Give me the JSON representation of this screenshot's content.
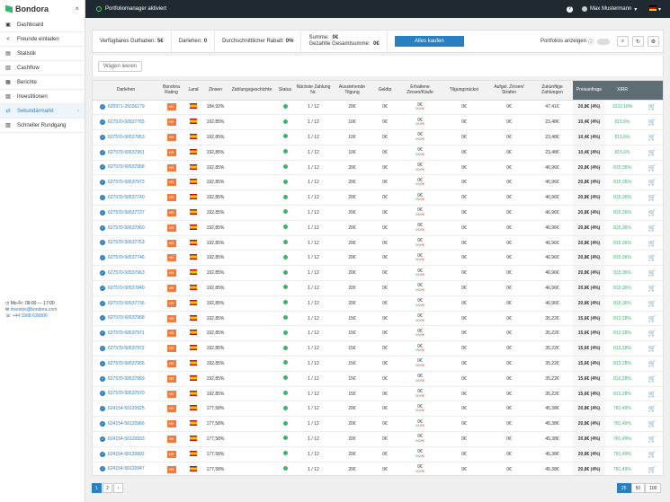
{
  "app": {
    "name": "Bondora",
    "close_icon": "×"
  },
  "nav": [
    {
      "label": "Dashboard",
      "icon": "▣"
    },
    {
      "label": "Freunde einladen",
      "icon": "<"
    },
    {
      "label": "Statistik",
      "icon": "▤"
    },
    {
      "label": "Cashflow",
      "icon": "▥"
    },
    {
      "label": "Berichte",
      "icon": "▦"
    },
    {
      "label": "Investitionen",
      "icon": "▧"
    },
    {
      "label": "Sekundärmarkt",
      "icon": "⇄",
      "active": true
    },
    {
      "label": "Schneller Rundgang",
      "icon": "▨"
    }
  ],
  "contact": {
    "hours": "Mo-Fr: 09:00 — 17:00",
    "email": "investor@bondora.com",
    "phone": "+44 1568 630006"
  },
  "topbar": {
    "status": "Portfoliomanager aktiviert",
    "help": "?",
    "user": "Max Mustermann"
  },
  "summary": {
    "balance_label": "Verfügbares Guthaben:",
    "balance_value": "5€",
    "loans_label": "Darlehen:",
    "loans_value": "0",
    "discount_label": "Durchschnittlicher Rabatt:",
    "discount_value": "0%",
    "sum_label": "Summe:",
    "sum_value": "0€",
    "total_label": "Gezahlte Gesamtsumme:",
    "total_value": "0€",
    "buy_all": "Alles kaufen",
    "show_portfolios": "Portfolios anzeigen"
  },
  "cart": {
    "clear": "Wagen leeren"
  },
  "columns": [
    "Darlehen",
    "Bondora Rating",
    "Land",
    "Zinsen",
    "Zahlungsgeschichte",
    "Status",
    "Nächste Zahlung Nr.",
    "Ausstehende Tilgung",
    "Geldtp",
    "Erhaltene Zinsen/Käufe",
    "Tilgungsrückst",
    "Aufgel. Zinsen/ Strafen",
    "Zukünftige Zahlungen",
    "Preisanfrage",
    "XIRR",
    ""
  ],
  "rows": [
    {
      "id": "620971-29336179",
      "rating": "HR",
      "rate": "184,92%",
      "next": "1 / 12",
      "outstanding": "20€",
      "lent": "0€",
      "zk": "0€",
      "zk_g": "0€",
      "zk_r": "0€",
      "arrears": "0€",
      "interest": "0€",
      "future": "47,41€",
      "price": "20,8€ (4%)",
      "xirr": "1032,18%"
    },
    {
      "id": "627570-50537765",
      "rating": "HR",
      "rate": "192,85%",
      "next": "1 / 12",
      "outstanding": "10€",
      "lent": "0€",
      "zk": "0€",
      "zk_g": "0€",
      "zk_r": "0€",
      "arrears": "0€",
      "interest": "0€",
      "future": "23,48€",
      "price": "10,4€ (4%)",
      "xirr": "815,6%"
    },
    {
      "id": "627570-50537953",
      "rating": "HR",
      "rate": "192,85%",
      "next": "1 / 12",
      "outstanding": "10€",
      "lent": "0€",
      "zk": "0€",
      "zk_g": "0€",
      "zk_r": "0€",
      "arrears": "0€",
      "interest": "0€",
      "future": "23,48€",
      "price": "10,4€ (4%)",
      "xirr": "815,6%"
    },
    {
      "id": "627570-50537951",
      "rating": "HR",
      "rate": "192,85%",
      "next": "1 / 12",
      "outstanding": "10€",
      "lent": "0€",
      "zk": "0€",
      "zk_g": "0€",
      "zk_r": "0€",
      "arrears": "0€",
      "interest": "0€",
      "future": "23,48€",
      "price": "10,4€ (4%)",
      "xirr": "815,6%"
    },
    {
      "id": "627570-50537958",
      "rating": "HR",
      "rate": "192,85%",
      "next": "1 / 12",
      "outstanding": "20€",
      "lent": "0€",
      "zk": "0€",
      "zk_g": "0€",
      "zk_r": "0€",
      "arrears": "0€",
      "interest": "0€",
      "future": "46,96€",
      "price": "20,8€ (4%)",
      "xirr": "815,36%"
    },
    {
      "id": "627570-50537973",
      "rating": "HR",
      "rate": "192,85%",
      "next": "1 / 12",
      "outstanding": "20€",
      "lent": "0€",
      "zk": "0€",
      "zk_g": "0€",
      "zk_r": "0€",
      "arrears": "0€",
      "interest": "0€",
      "future": "46,96€",
      "price": "20,8€ (4%)",
      "xirr": "815,36%"
    },
    {
      "id": "627570-50537740",
      "rating": "HR",
      "rate": "192,85%",
      "next": "1 / 12",
      "outstanding": "20€",
      "lent": "0€",
      "zk": "0€",
      "zk_g": "0€",
      "zk_r": "0€",
      "arrears": "0€",
      "interest": "0€",
      "future": "46,96€",
      "price": "20,8€ (4%)",
      "xirr": "815,36%"
    },
    {
      "id": "627570-50537727",
      "rating": "HR",
      "rate": "192,85%",
      "next": "1 / 12",
      "outstanding": "20€",
      "lent": "0€",
      "zk": "0€",
      "zk_g": "0€",
      "zk_r": "0€",
      "arrears": "0€",
      "interest": "0€",
      "future": "46,96€",
      "price": "20,8€ (4%)",
      "xirr": "815,36%"
    },
    {
      "id": "627570-50537960",
      "rating": "HR",
      "rate": "192,85%",
      "next": "1 / 12",
      "outstanding": "20€",
      "lent": "0€",
      "zk": "0€",
      "zk_g": "0€",
      "zk_r": "0€",
      "arrears": "0€",
      "interest": "0€",
      "future": "46,96€",
      "price": "20,8€ (4%)",
      "xirr": "815,36%"
    },
    {
      "id": "627570-50537753",
      "rating": "HR",
      "rate": "192,85%",
      "next": "1 / 12",
      "outstanding": "20€",
      "lent": "0€",
      "zk": "0€",
      "zk_g": "0€",
      "zk_r": "0€",
      "arrears": "0€",
      "interest": "0€",
      "future": "46,96€",
      "price": "20,8€ (4%)",
      "xirr": "815,36%"
    },
    {
      "id": "627570-50537746",
      "rating": "HR",
      "rate": "192,85%",
      "next": "1 / 12",
      "outstanding": "20€",
      "lent": "0€",
      "zk": "0€",
      "zk_g": "0€",
      "zk_r": "0€",
      "arrears": "0€",
      "interest": "0€",
      "future": "46,96€",
      "price": "20,8€ (4%)",
      "xirr": "815,36%"
    },
    {
      "id": "627570-50537963",
      "rating": "HR",
      "rate": "192,85%",
      "next": "1 / 12",
      "outstanding": "20€",
      "lent": "0€",
      "zk": "0€",
      "zk_g": "0€",
      "zk_r": "0€",
      "arrears": "0€",
      "interest": "0€",
      "future": "46,96€",
      "price": "20,8€ (4%)",
      "xirr": "815,36%"
    },
    {
      "id": "627570-50537840",
      "rating": "HR",
      "rate": "192,85%",
      "next": "1 / 12",
      "outstanding": "20€",
      "lent": "0€",
      "zk": "0€",
      "zk_g": "0€",
      "zk_r": "0€",
      "arrears": "0€",
      "interest": "0€",
      "future": "46,96€",
      "price": "20,8€ (4%)",
      "xirr": "815,36%"
    },
    {
      "id": "627570-50537736",
      "rating": "HR",
      "rate": "192,85%",
      "next": "1 / 12",
      "outstanding": "20€",
      "lent": "0€",
      "zk": "0€",
      "zk_g": "0€",
      "zk_r": "0€",
      "arrears": "0€",
      "interest": "0€",
      "future": "46,96€",
      "price": "20,8€ (4%)",
      "xirr": "815,36%"
    },
    {
      "id": "627570-50537968",
      "rating": "HR",
      "rate": "192,85%",
      "next": "1 / 12",
      "outstanding": "15€",
      "lent": "0€",
      "zk": "0€",
      "zk_g": "0€",
      "zk_r": "0€",
      "arrears": "0€",
      "interest": "0€",
      "future": "35,22€",
      "price": "15,6€ (4%)",
      "xirr": "813,28%"
    },
    {
      "id": "627570-50537971",
      "rating": "HR",
      "rate": "192,85%",
      "next": "1 / 12",
      "outstanding": "15€",
      "lent": "0€",
      "zk": "0€",
      "zk_g": "0€",
      "zk_r": "0€",
      "arrears": "0€",
      "interest": "0€",
      "future": "35,22€",
      "price": "15,6€ (4%)",
      "xirr": "813,28%"
    },
    {
      "id": "627570-50537972",
      "rating": "HR",
      "rate": "192,85%",
      "next": "1 / 12",
      "outstanding": "15€",
      "lent": "0€",
      "zk": "0€",
      "zk_g": "0€",
      "zk_r": "0€",
      "arrears": "0€",
      "interest": "0€",
      "future": "35,22€",
      "price": "15,6€ (4%)",
      "xirr": "813,28%"
    },
    {
      "id": "627570-50537956",
      "rating": "HR",
      "rate": "192,85%",
      "next": "1 / 12",
      "outstanding": "15€",
      "lent": "0€",
      "zk": "0€",
      "zk_g": "0€",
      "zk_r": "0€",
      "arrears": "0€",
      "interest": "0€",
      "future": "35,22€",
      "price": "15,6€ (4%)",
      "xirr": "813,28%"
    },
    {
      "id": "627570-50537969",
      "rating": "HR",
      "rate": "192,85%",
      "next": "1 / 12",
      "outstanding": "15€",
      "lent": "0€",
      "zk": "0€",
      "zk_g": "0€",
      "zk_r": "0€",
      "arrears": "0€",
      "interest": "0€",
      "future": "35,22€",
      "price": "15,6€ (4%)",
      "xirr": "813,28%"
    },
    {
      "id": "627570-50537970",
      "rating": "HR",
      "rate": "192,85%",
      "next": "1 / 12",
      "outstanding": "15€",
      "lent": "0€",
      "zk": "0€",
      "zk_g": "0€",
      "zk_r": "0€",
      "arrears": "0€",
      "interest": "0€",
      "future": "35,22€",
      "price": "15,6€ (4%)",
      "xirr": "813,28%"
    },
    {
      "id": "624154-50120925",
      "rating": "HR",
      "rate": "177,58%",
      "next": "1 / 12",
      "outstanding": "20€",
      "lent": "0€",
      "zk": "0€",
      "zk_g": "0€",
      "zk_r": "0€",
      "arrears": "0€",
      "interest": "0€",
      "future": "45,38€",
      "price": "20,8€ (4%)",
      "xirr": "781,49%"
    },
    {
      "id": "624154-50120966",
      "rating": "HR",
      "rate": "177,58%",
      "next": "1 / 12",
      "outstanding": "20€",
      "lent": "0€",
      "zk": "0€",
      "zk_g": "0€",
      "zk_r": "0€",
      "arrears": "0€",
      "interest": "0€",
      "future": "45,38€",
      "price": "20,8€ (4%)",
      "xirr": "781,49%"
    },
    {
      "id": "624154-50120933",
      "rating": "HR",
      "rate": "177,58%",
      "next": "1 / 12",
      "outstanding": "20€",
      "lent": "0€",
      "zk": "0€",
      "zk_g": "0€",
      "zk_r": "0€",
      "arrears": "0€",
      "interest": "0€",
      "future": "45,38€",
      "price": "20,8€ (4%)",
      "xirr": "781,49%"
    },
    {
      "id": "624154-50120892",
      "rating": "HR",
      "rate": "177,58%",
      "next": "1 / 12",
      "outstanding": "20€",
      "lent": "0€",
      "zk": "0€",
      "zk_g": "0€",
      "zk_r": "0€",
      "arrears": "0€",
      "interest": "0€",
      "future": "45,38€",
      "price": "20,8€ (4%)",
      "xirr": "781,49%"
    },
    {
      "id": "624154-50120947",
      "rating": "HR",
      "rate": "177,58%",
      "next": "1 / 12",
      "outstanding": "20€",
      "lent": "0€",
      "zk": "0€",
      "zk_g": "0€",
      "zk_r": "0€",
      "arrears": "0€",
      "interest": "0€",
      "future": "45,38€",
      "price": "20,8€ (4%)",
      "xirr": "781,49%"
    }
  ],
  "pagination": {
    "pages": [
      "1",
      "2",
      "›"
    ],
    "sizes": [
      "25",
      "50",
      "100"
    ]
  },
  "colors": {
    "accent": "#2a7fc1",
    "positive": "#3cb371",
    "rating": "#f47a3a",
    "topbar": "#1f2a30"
  }
}
